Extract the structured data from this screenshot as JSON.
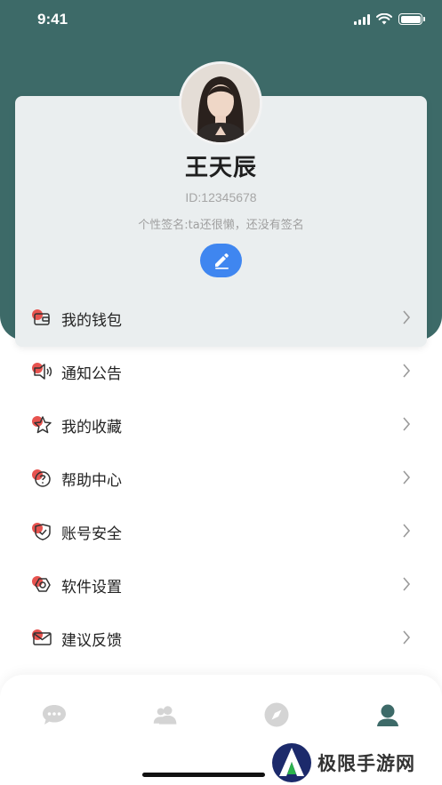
{
  "status_bar": {
    "time": "9:41"
  },
  "profile": {
    "name": "王天辰",
    "id": "ID:12345678",
    "signature": "个性签名:ta还很懒，还没有签名"
  },
  "menu": {
    "items": [
      {
        "label": "我的钱包",
        "icon": "wallet-icon"
      },
      {
        "label": "通知公告",
        "icon": "speaker-icon"
      },
      {
        "label": "我的收藏",
        "icon": "star-icon"
      },
      {
        "label": "帮助中心",
        "icon": "help-icon"
      },
      {
        "label": "账号安全",
        "icon": "shield-icon"
      },
      {
        "label": "软件设置",
        "icon": "settings-icon"
      },
      {
        "label": "建议反馈",
        "icon": "mail-icon"
      }
    ]
  },
  "tabs": [
    {
      "icon": "chat-icon",
      "active": false
    },
    {
      "icon": "contacts-icon",
      "active": false
    },
    {
      "icon": "discover-icon",
      "active": false
    },
    {
      "icon": "profile-icon",
      "active": true
    }
  ],
  "watermark": {
    "text": "极限手游网"
  },
  "colors": {
    "header": "#3d6a68",
    "card": "#eaeeef",
    "accent_red": "#e7534f",
    "edit_blue": "#3f86f0",
    "tab_active": "#3d6a68",
    "tab_inactive": "#d4d4d4"
  }
}
